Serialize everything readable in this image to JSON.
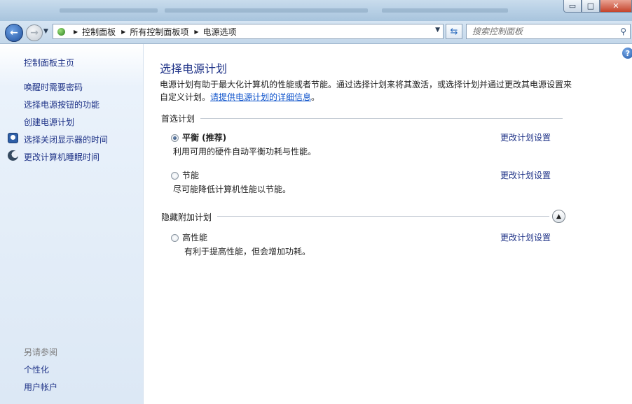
{
  "window": {
    "minimize_glyph": "▭",
    "maximize_glyph": "□",
    "close_glyph": "✕"
  },
  "address": {
    "crumbs": [
      "控制面板",
      "所有控制面板项",
      "电源选项"
    ]
  },
  "search": {
    "placeholder": "搜索控制面板"
  },
  "sidebar": {
    "home": "控制面板主页",
    "links": [
      "唤醒时需要密码",
      "选择电源按钮的功能",
      "创建电源计划",
      "选择关闭显示器的时间",
      "更改计算机睡眠时间"
    ],
    "see_also_title": "另请参阅",
    "see_also": [
      "个性化",
      "用户帐户"
    ]
  },
  "main": {
    "title": "选择电源计划",
    "description": "电源计划有助于最大化计算机的性能或者节能。通过选择计划来将其激活，或选择计划并通过更改其电源设置来自定义计划。",
    "description_link": "请提供电源计划的详细信息",
    "description_end": "。",
    "preferred_label": "首选计划",
    "hidden_label": "隐藏附加计划",
    "change_link": "更改计划设置",
    "plans": [
      {
        "name": "平衡 (推荐)",
        "desc": "利用可用的硬件自动平衡功耗与性能。",
        "selected": true
      },
      {
        "name": "节能",
        "desc": "尽可能降低计算机性能以节能。",
        "selected": false
      },
      {
        "name": "高性能",
        "desc": "有利于提高性能，但会增加功耗。",
        "selected": false
      }
    ]
  },
  "colors": {
    "link": "#1e3287",
    "hyperlink": "#1155cc",
    "sidebar_bg": "#dce8f5"
  }
}
